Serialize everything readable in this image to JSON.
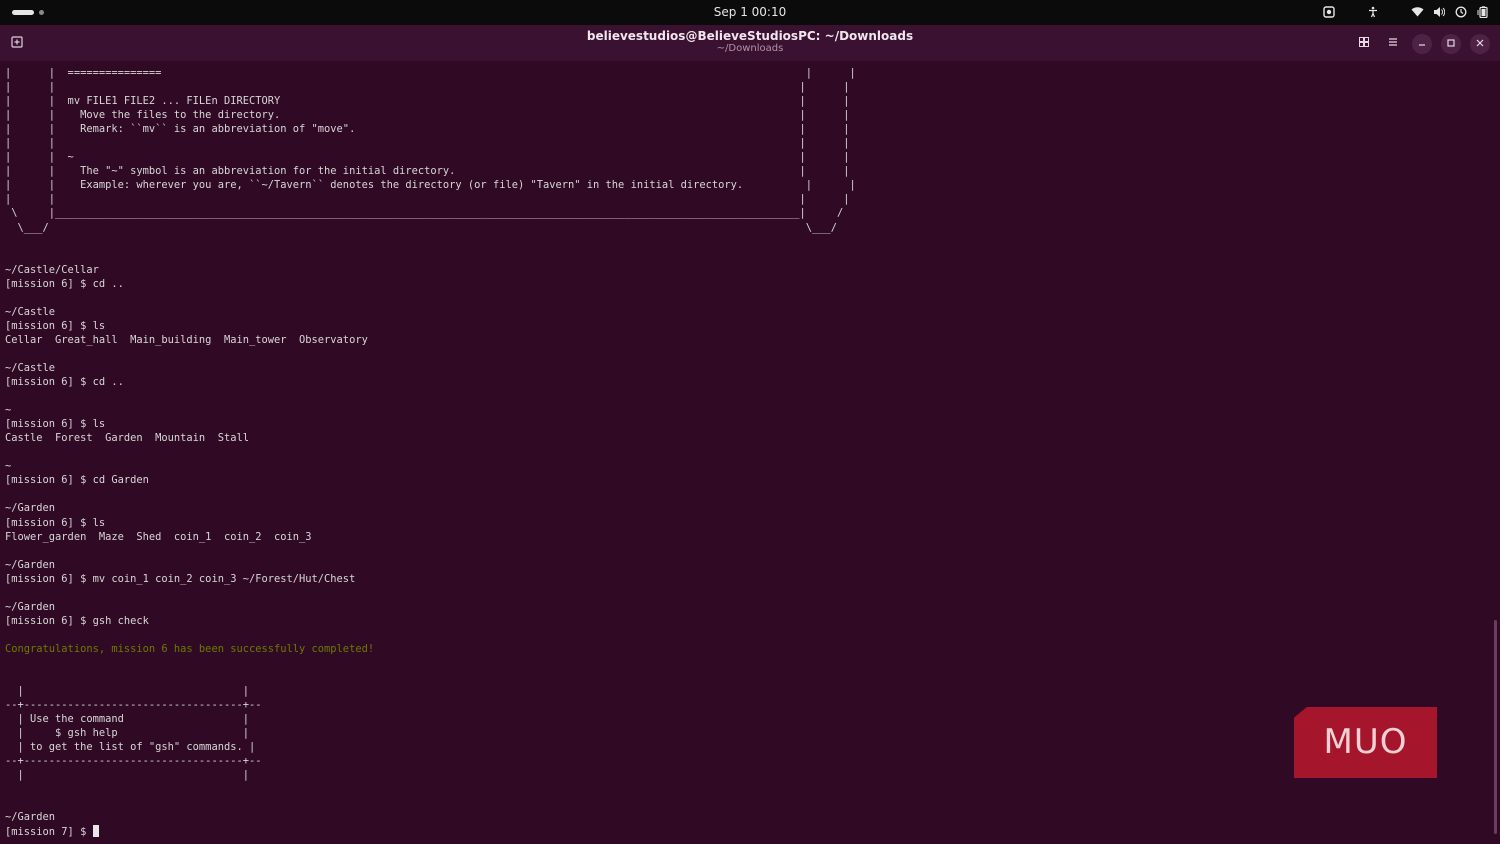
{
  "system_bar": {
    "clock": "Sep 1  00:10"
  },
  "window": {
    "title": "believestudios@BelieveStudiosPC: ~/Downloads",
    "subtitle": "~/Downloads"
  },
  "terminal": {
    "lines": [
      "|      |  ===============                                                                                                       |      |",
      "|      |                                                                                                                       |      |",
      "|      |  mv FILE1 FILE2 ... FILEn DIRECTORY                                                                                   |      |",
      "|      |    Move the files to the directory.                                                                                   |      |",
      "|      |    Remark: ``mv`` is an abbreviation of \"move\".                                                                       |      |",
      "|      |                                                                                                                       |      |",
      "|      |  ~                                                                                                                    |      |",
      "|      |    The \"~\" symbol is an abbreviation for the initial directory.                                                       |      |",
      "|      |    Example: wherever you are, ``~/Tavern`` denotes the directory (or file) \"Tavern\" in the initial directory.          |      |",
      "|      |                                                                                                                       |      |",
      " \\     |_______________________________________________________________________________________________________________________|     /",
      "  \\___/                                                                                                                         \\___/",
      "",
      "",
      "~/Castle/Cellar",
      "[mission 6] $ cd ..",
      "",
      "~/Castle",
      "[mission 6] $ ls",
      "Cellar  Great_hall  Main_building  Main_tower  Observatory",
      "",
      "~/Castle",
      "[mission 6] $ cd ..",
      "",
      "~",
      "[mission 6] $ ls",
      "Castle  Forest  Garden  Mountain  Stall",
      "",
      "~",
      "[mission 6] $ cd Garden",
      "",
      "~/Garden",
      "[mission 6] $ ls",
      "Flower_garden  Maze  Shed  coin_1  coin_2  coin_3",
      "",
      "~/Garden",
      "[mission 6] $ mv coin_1 coin_2 coin_3 ~/Forest/Hut/Chest",
      "",
      "~/Garden",
      "[mission 6] $ gsh check",
      "",
      "Congratulations, mission 6 has been successfully completed!",
      "",
      "",
      "  |                                   |",
      "--+-----------------------------------+--",
      "  | Use the command                   |",
      "  |     $ gsh help                    |",
      "  | to get the list of \"gsh\" commands. |",
      "--+-----------------------------------+--",
      "  |                                   |",
      "",
      "",
      "~/Garden"
    ],
    "prompt": "[mission 7] $ ",
    "success_color": "#6b7a00"
  },
  "watermark": {
    "text": "MUO",
    "color": "#a5162c"
  },
  "icons": {
    "tray": [
      "screen-record-icon",
      "accessibility-icon",
      "wifi-icon",
      "volume-icon",
      "power-profile-icon",
      "battery-icon"
    ],
    "titlebar": [
      "new-tab-icon",
      "view-tabs-icon",
      "menu-icon",
      "minimize-icon",
      "maximize-icon",
      "close-icon"
    ]
  }
}
